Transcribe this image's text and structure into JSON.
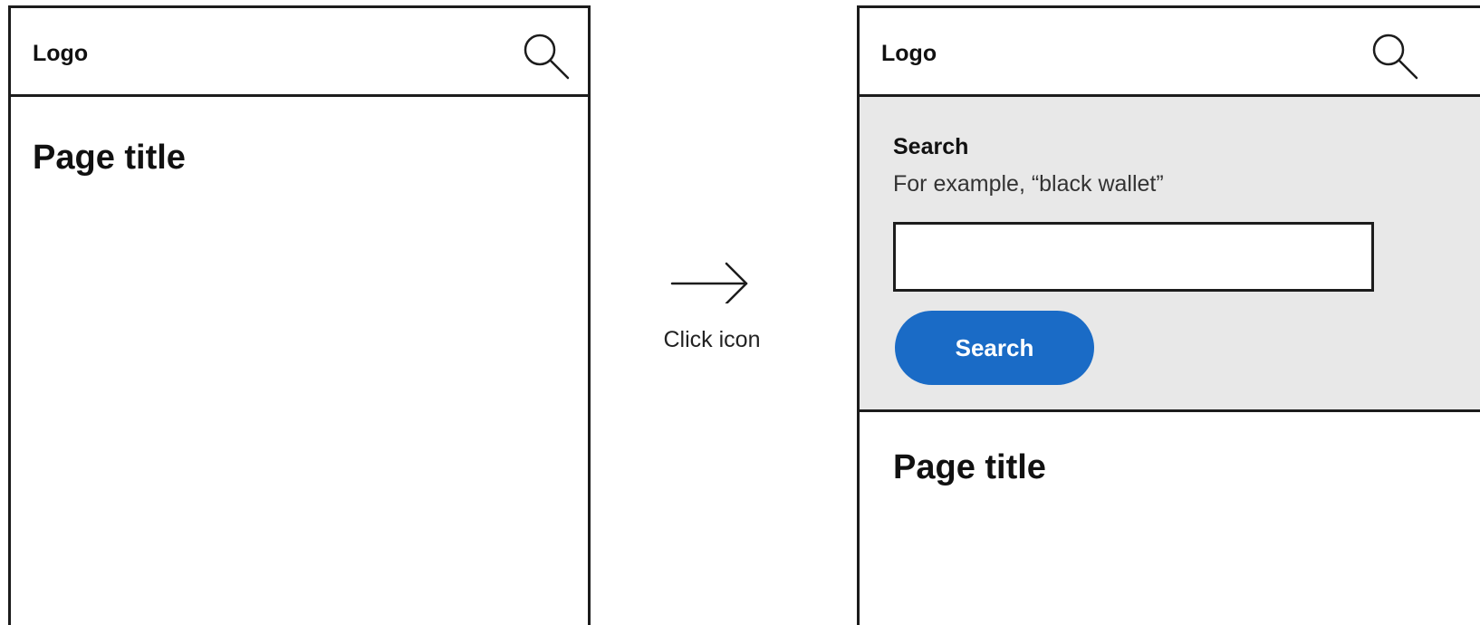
{
  "before": {
    "header": {
      "logo": "Logo",
      "search_icon": "search-icon"
    },
    "page_title": "Page title"
  },
  "transition": {
    "icon": "arrow-right-icon",
    "label": "Click icon"
  },
  "after": {
    "header": {
      "logo": "Logo",
      "search_icon": "search-icon"
    },
    "search_panel": {
      "label": "Search",
      "hint": "For example, “black wallet”",
      "input_value": "",
      "button_label": "Search",
      "background": "#e8e8e8",
      "button_color": "#1a6bc6"
    },
    "page_title": "Page title"
  }
}
